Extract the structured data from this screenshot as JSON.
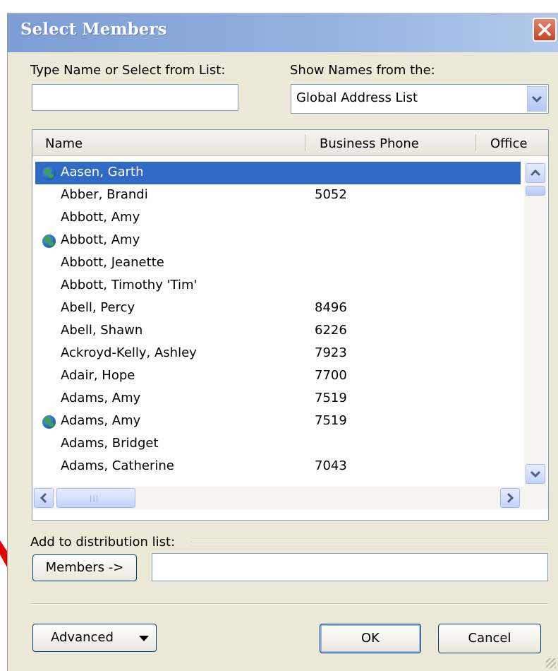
{
  "window": {
    "title": "Select Members"
  },
  "search": {
    "label": "Type Name or Select from List:",
    "value": ""
  },
  "address_book": {
    "label": "Show Names from the:",
    "selected": "Global Address List"
  },
  "columns": [
    "Name",
    "Business Phone",
    "Office"
  ],
  "rows": [
    {
      "name": "Aasen, Garth",
      "phone": "",
      "globe": true,
      "selected": true
    },
    {
      "name": "Abber, Brandi",
      "phone": "5052",
      "globe": false
    },
    {
      "name": "Abbott, Amy",
      "phone": "",
      "globe": false
    },
    {
      "name": "Abbott, Amy",
      "phone": "",
      "globe": true
    },
    {
      "name": "Abbott, Jeanette",
      "phone": "",
      "globe": false
    },
    {
      "name": "Abbott, Timothy 'Tim'",
      "phone": "",
      "globe": false
    },
    {
      "name": "Abell, Percy",
      "phone": "8496",
      "globe": false
    },
    {
      "name": "Abell, Shawn",
      "phone": "6226",
      "globe": false
    },
    {
      "name": "Ackroyd-Kelly, Ashley",
      "phone": "7923",
      "globe": false
    },
    {
      "name": "Adair, Hope",
      "phone": "7700",
      "globe": false
    },
    {
      "name": "Adams, Amy",
      "phone": "7519",
      "globe": false
    },
    {
      "name": "Adams, Amy",
      "phone": "7519",
      "globe": true
    },
    {
      "name": "Adams, Bridget",
      "phone": "",
      "globe": false
    },
    {
      "name": "Adams, Catherine",
      "phone": "7043",
      "globe": false
    }
  ],
  "distribution": {
    "label": "Add to distribution list:",
    "members_button": "Members ->",
    "members_value": ""
  },
  "buttons": {
    "advanced": "Advanced",
    "ok": "OK",
    "cancel": "Cancel"
  },
  "colors": {
    "title_bar": "#7c9dd4",
    "selection": "#316ac5",
    "dialog_bg": "#ece9d8",
    "annotation_arrow": "#e00000"
  }
}
